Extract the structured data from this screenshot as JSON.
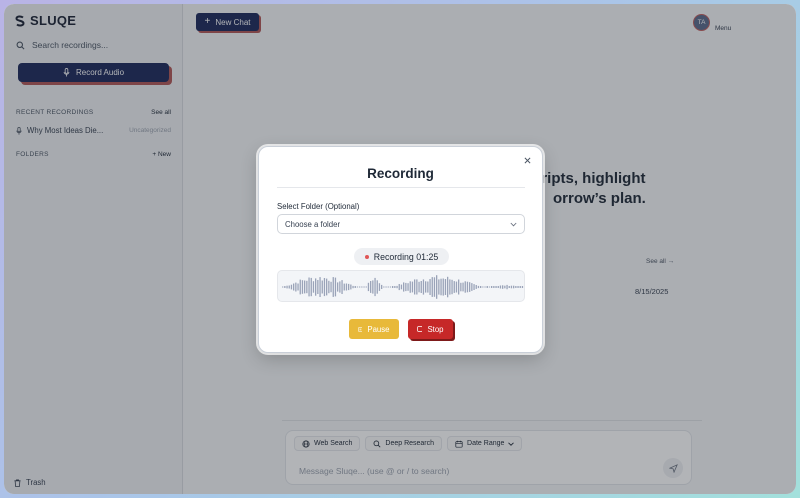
{
  "app": {
    "name": "SLUQE"
  },
  "sidebar": {
    "search_placeholder": "Search recordings...",
    "record_label": "Record Audio",
    "recent": {
      "title": "RECENT RECORDINGS",
      "see_all": "See all",
      "items": [
        {
          "name": "Why Most Ideas Die...",
          "tag": "Uncategorized"
        }
      ]
    },
    "folders": {
      "title": "FOLDERS",
      "new_label": "+ New"
    },
    "trash_label": "Trash"
  },
  "header": {
    "new_chat_label": "New Chat",
    "avatar_initials": "TA",
    "menu_label": "Menu"
  },
  "main": {
    "hero_lines": [
      "cripts, highlight",
      "orrow’s plan."
    ],
    "see_all": "See all →",
    "date": "8/15/2025"
  },
  "composer": {
    "chips": [
      {
        "label": "Web Search"
      },
      {
        "label": "Deep Research"
      },
      {
        "label": "Date Range"
      }
    ],
    "placeholder": "Message Sluqe... (use @ or / to search)"
  },
  "modal": {
    "title": "Recording",
    "folder_label": "Select Folder (Optional)",
    "folder_value": "Choose a folder",
    "status": "Recording 01:25",
    "pause_label": "Pause",
    "stop_label": "Stop"
  },
  "colors": {
    "brand_navy": "#1e2a5c",
    "accent_red": "#b15757",
    "pause": "#e8b93a",
    "stop": "#c62828",
    "wave": "#9aa3b8"
  }
}
